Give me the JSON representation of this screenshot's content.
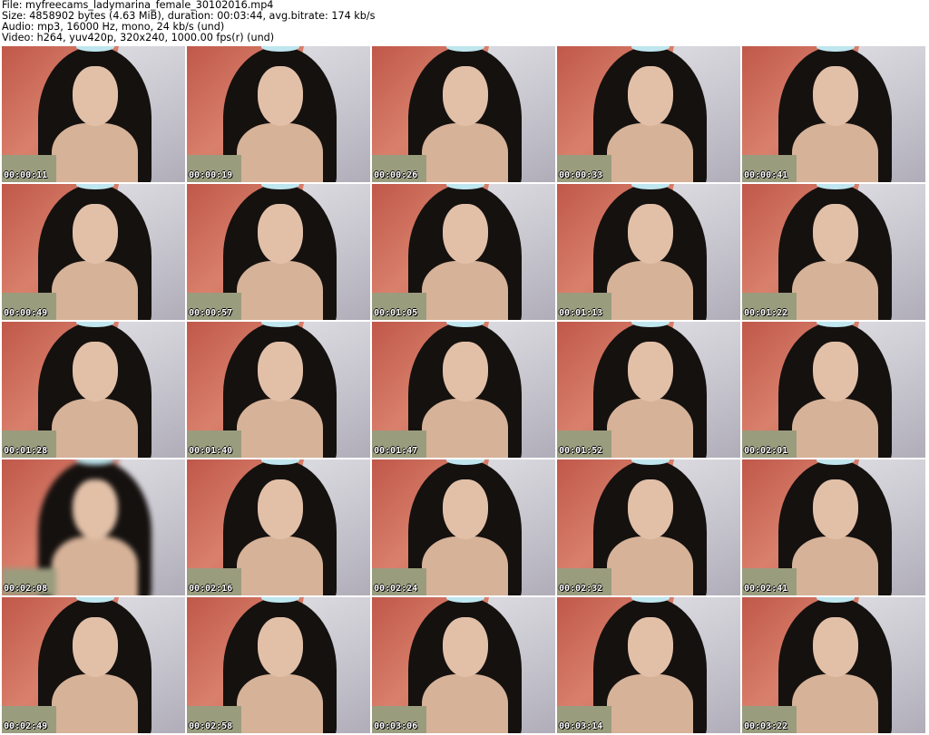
{
  "header": {
    "file": "File: myfreecams_ladymarina_female_30102016.mp4",
    "size": "Size: 4858902 bytes (4.63 MiB), duration: 00:03:44, avg.bitrate: 174 kb/s",
    "audio": "Audio: mp3, 16000 Hz, mono, 24 kb/s (und)",
    "video": "Video: h264, yuv420p, 320x240, 1000.00 fps(r) (und)"
  },
  "timestamps": [
    "00:00:11",
    "00:00:19",
    "00:00:26",
    "00:00:33",
    "00:00:41",
    "00:00:49",
    "00:00:57",
    "00:01:05",
    "00:01:13",
    "00:01:22",
    "00:01:28",
    "00:01:40",
    "00:01:47",
    "00:01:52",
    "00:02:01",
    "00:02:08",
    "00:02:16",
    "00:02:24",
    "00:02:32",
    "00:02:41",
    "00:02:49",
    "00:02:58",
    "00:03:06",
    "00:03:14",
    "00:03:22"
  ]
}
